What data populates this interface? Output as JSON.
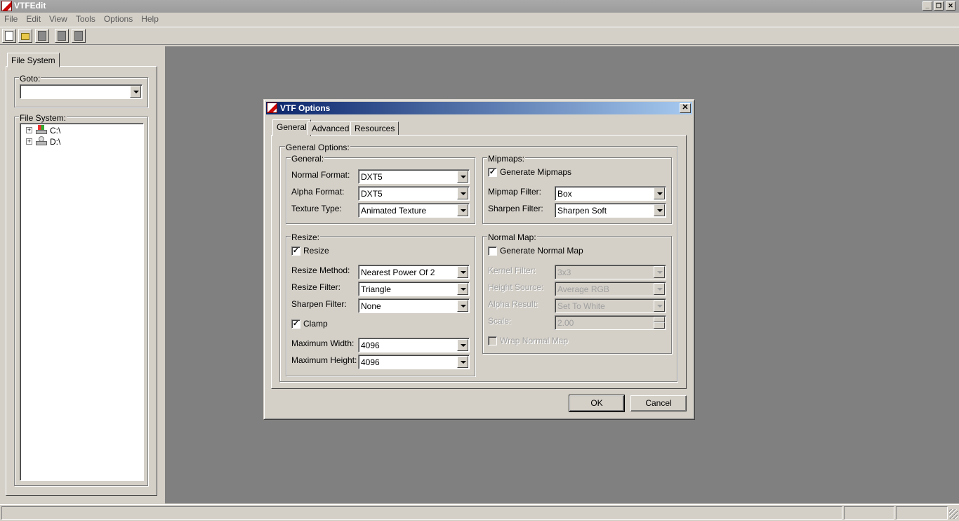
{
  "window": {
    "title": "VTFEdit",
    "min_icon": "minimize-icon",
    "restore_icon": "restore-icon",
    "close_icon": "close-icon"
  },
  "menu": [
    "File",
    "Edit",
    "View",
    "Tools",
    "Options",
    "Help"
  ],
  "toolbar": [
    "new-icon",
    "open-icon",
    "save-icon",
    "copy-icon",
    "paste-icon"
  ],
  "left_panel": {
    "tab_label": "File System",
    "goto_label": "Goto:",
    "goto_value": "",
    "filesystem_label": "File System:",
    "drives": [
      {
        "label": "C:\\",
        "icon": "drive-c-icon"
      },
      {
        "label": "D:\\",
        "icon": "drive-d-icon"
      }
    ]
  },
  "dialog": {
    "title": "VTF Options",
    "tabs": [
      "General",
      "Advanced",
      "Resources"
    ],
    "active_tab": "General",
    "general_options_label": "General Options:",
    "general": {
      "label": "General:",
      "normal_format_label": "Normal Format:",
      "normal_format_value": "DXT5",
      "alpha_format_label": "Alpha Format:",
      "alpha_format_value": "DXT5",
      "texture_type_label": "Texture Type:",
      "texture_type_value": "Animated Texture"
    },
    "mipmaps": {
      "label": "Mipmaps:",
      "generate_label": "Generate Mipmaps",
      "generate_checked": true,
      "filter_label": "Mipmap Filter:",
      "filter_value": "Box",
      "sharpen_label": "Sharpen Filter:",
      "sharpen_value": "Sharpen Soft"
    },
    "resize": {
      "label": "Resize:",
      "resize_label": "Resize",
      "resize_checked": true,
      "method_label": "Resize Method:",
      "method_value": "Nearest Power Of 2",
      "filter_label": "Resize Filter:",
      "filter_value": "Triangle",
      "sharpen_label": "Sharpen Filter:",
      "sharpen_value": "None",
      "clamp_label": "Clamp",
      "clamp_checked": true,
      "max_width_label": "Maximum Width:",
      "max_width_value": "4096",
      "max_height_label": "Maximum Height:",
      "max_height_value": "4096"
    },
    "normal_map": {
      "label": "Normal Map:",
      "generate_label": "Generate Normal Map",
      "generate_checked": false,
      "kernel_label": "Kernel Filter:",
      "kernel_value": "3x3",
      "height_source_label": "Height Source:",
      "height_source_value": "Average RGB",
      "alpha_result_label": "Alpha Result:",
      "alpha_result_value": "Set To White",
      "scale_label": "Scale:",
      "scale_value": "2.00",
      "wrap_label": "Wrap Normal Map",
      "wrap_checked": false
    },
    "ok_label": "OK",
    "cancel_label": "Cancel"
  }
}
